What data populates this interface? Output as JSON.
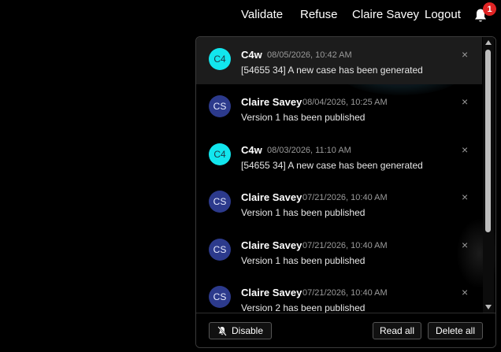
{
  "nav": {
    "validate": "Validate",
    "refuse": "Refuse",
    "user": "Claire Savey",
    "logout": "Logout",
    "notification_count": "1",
    "bell_icon": "bell-icon"
  },
  "notifications": {
    "items": [
      {
        "initials": "C4",
        "author": "C4w",
        "date": "08/05/2026, 10:42 AM",
        "message": "[54655 34] A new case has been generated",
        "avatar_color": "#12e6ee"
      },
      {
        "initials": "CS",
        "author": "Claire Savey",
        "date": "08/04/2026, 10:25 AM",
        "message": "Version 1 has been published",
        "avatar_color": "#2c3a8c"
      },
      {
        "initials": "C4",
        "author": "C4w",
        "date": "08/03/2026, 11:10 AM",
        "message": "[54655 34] A new case has been generated",
        "avatar_color": "#12e6ee"
      },
      {
        "initials": "CS",
        "author": "Claire Savey",
        "date": "07/21/2026, 10:40 AM",
        "message": "Version 1 has been published",
        "avatar_color": "#2c3a8c"
      },
      {
        "initials": "CS",
        "author": "Claire Savey",
        "date": "07/21/2026, 10:40 AM",
        "message": "Version 1 has been published",
        "avatar_color": "#2c3a8c"
      },
      {
        "initials": "CS",
        "author": "Claire Savey",
        "date": "07/21/2026, 10:40 AM",
        "message": "Version 2 has been published",
        "avatar_color": "#2c3a8c"
      }
    ],
    "close_symbol": "×"
  },
  "footer": {
    "disable_label": "Disable",
    "read_all_label": "Read all",
    "delete_all_label": "Delete all"
  }
}
